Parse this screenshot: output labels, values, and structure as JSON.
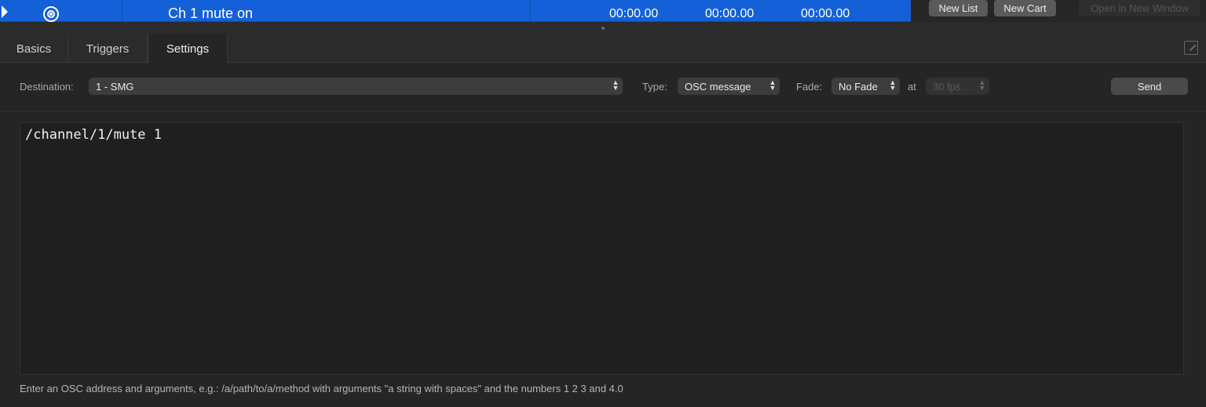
{
  "cue": {
    "name": "Ch 1 mute on",
    "pre_wait": "00:00.00",
    "action": "00:00.00",
    "post_wait": "00:00.00"
  },
  "toolbar": {
    "new_list": "New List",
    "new_cart": "New Cart",
    "open_new_window": "Open in New Window"
  },
  "tabs": [
    {
      "label": "Basics"
    },
    {
      "label": "Triggers"
    },
    {
      "label": "Settings"
    }
  ],
  "settings": {
    "destination_label": "Destination:",
    "destination_value": "1 - SMG",
    "type_label": "Type:",
    "type_value": "OSC message",
    "fade_label": "Fade:",
    "fade_value": "No Fade",
    "at_label": "at",
    "fps_value": "30 fps",
    "send_label": "Send"
  },
  "editor": {
    "content": "/channel/1/mute 1"
  },
  "hint": "Enter an OSC address and arguments, e.g.: /a/path/to/a/method with arguments \"a string with spaces\" and the numbers 1 2 3 and 4.0",
  "colors": {
    "cue_selected": "#1460d8",
    "background": "#252525"
  }
}
